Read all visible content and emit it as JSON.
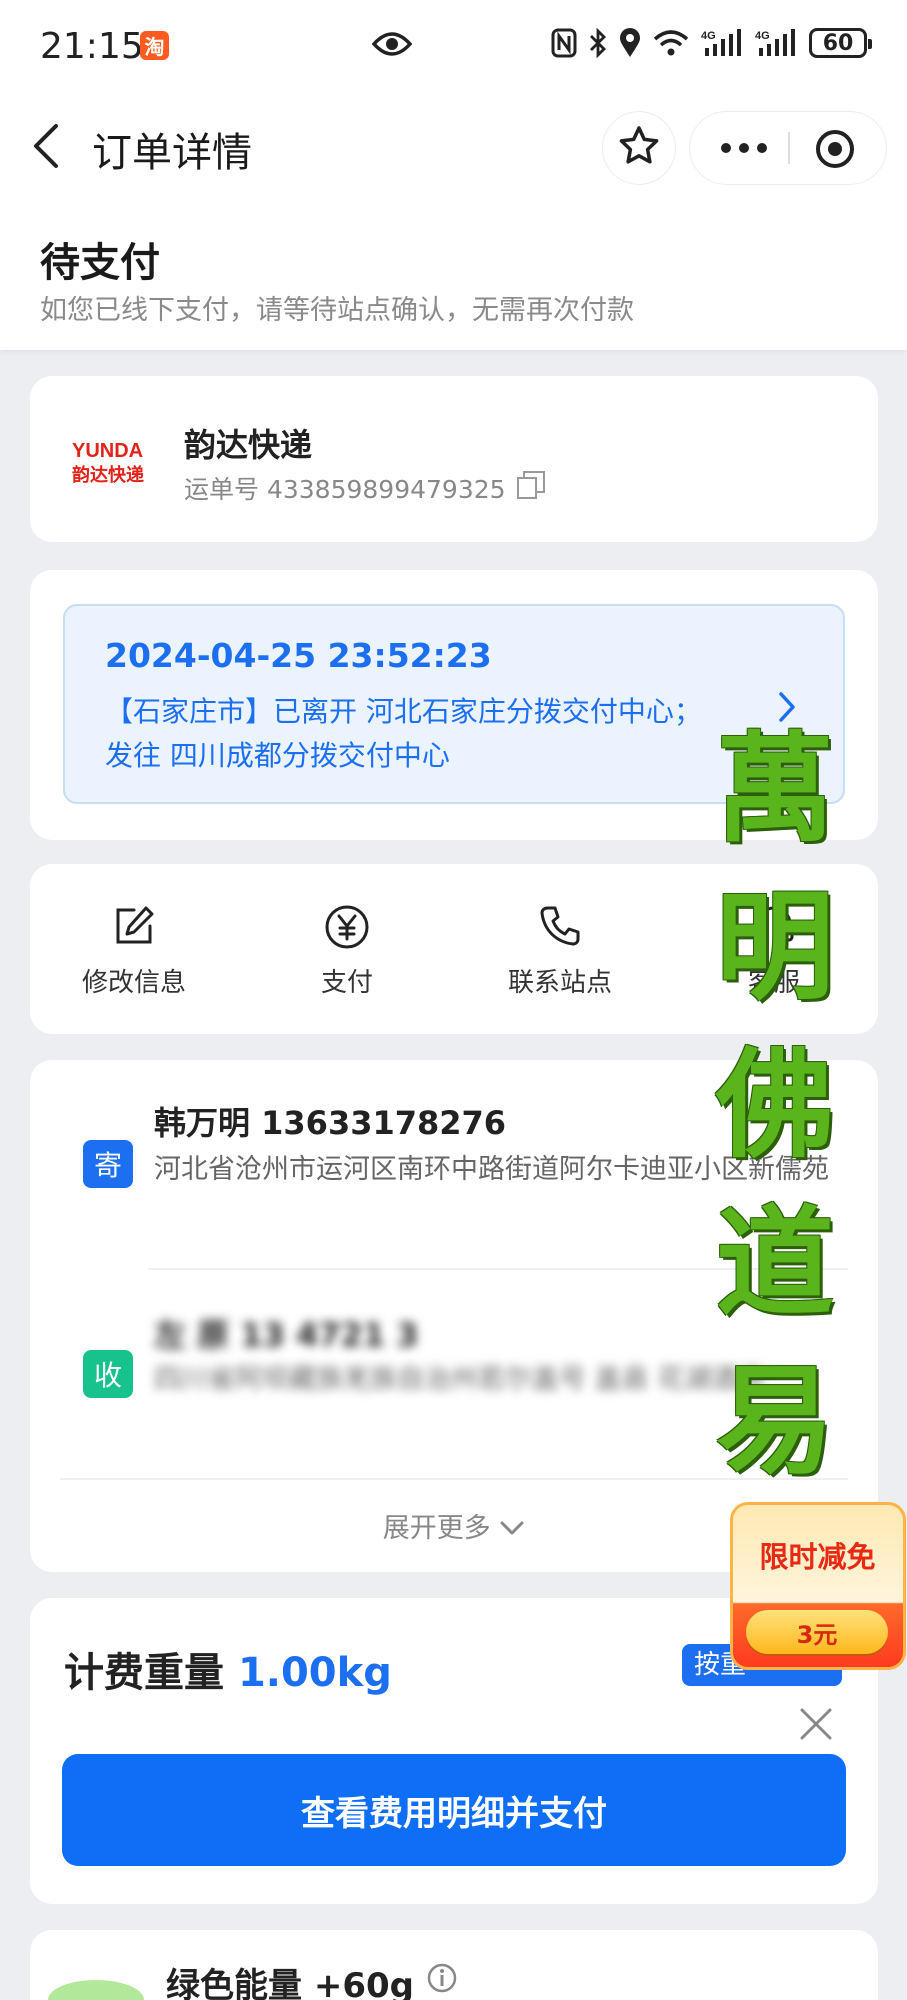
{
  "status_bar": {
    "time": "21:15",
    "app_icon": "淘",
    "network_1": "4G",
    "network_2": "4G",
    "battery": "60"
  },
  "nav": {
    "title": "订单详情",
    "icons": [
      "back-chevron-icon",
      "star-icon",
      "more-dots-icon",
      "target-circle-icon"
    ]
  },
  "order_status": {
    "title": "待支付",
    "subtitle": "如您已线下支付，请等待站点确认，无需再次付款"
  },
  "courier": {
    "logo_en": "YUNDA",
    "logo_cn": "韵达快递",
    "name": "韵达快递",
    "waybill_label": "运单号 433859899479325"
  },
  "tracking": {
    "datetime": "2024-04-25 23:52:23",
    "description": "【石家庄市】已离开 河北石家庄分拨交付中心；发往 四川成都分拨交付中心"
  },
  "actions": [
    {
      "label": "修改信息",
      "icon": "edit-icon"
    },
    {
      "label": "支付",
      "icon": "yen-circle-icon"
    },
    {
      "label": "联系站点",
      "icon": "phone-icon"
    },
    {
      "label": "客服",
      "icon": "headset-icon"
    }
  ],
  "sender": {
    "badge": "寄",
    "name_phone": "韩万明 13633178276",
    "address": "河北省沧州市运河区南环中路街道阿尔卡迪亚小区新儒苑"
  },
  "receiver": {
    "badge": "收",
    "name_phone": "左 原 13 4721 3",
    "address": "四川省阿坝藏族羌族自治州若尔盖号 盖县 花湖酒店"
  },
  "expand_label": "展开更多",
  "fee": {
    "label": "计费重量",
    "weight": "1.00kg",
    "tag": "按重",
    "pay_button": "查看费用明细并支付"
  },
  "energy": {
    "title": "绿色能量 +60g"
  },
  "promo": {
    "title": "限时减免",
    "coupon": "3元"
  },
  "watermark": [
    "萬",
    "明",
    "佛",
    "道",
    "易"
  ],
  "colors": {
    "primary_blue": "#1b6ff0",
    "send_badge": "#1b6ff0",
    "receive_badge": "#18c28c",
    "watermark_green": "#5ab51d",
    "promo_red": "#e82a14"
  }
}
